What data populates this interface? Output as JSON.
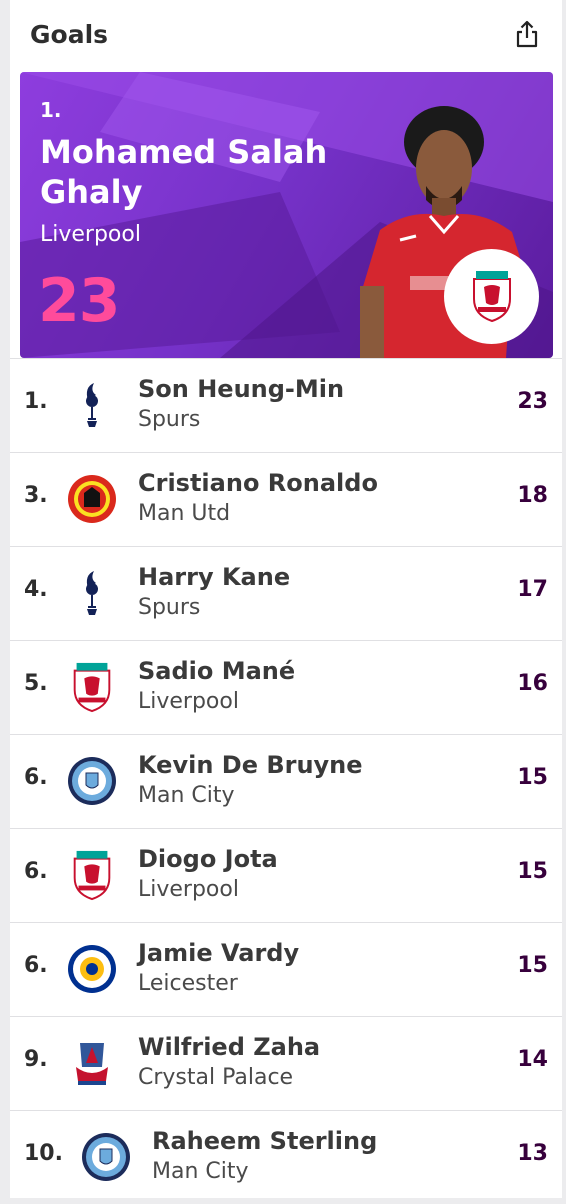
{
  "header": {
    "title": "Goals",
    "share_icon": "share-icon"
  },
  "leader": {
    "rank": "1.",
    "name": "Mohamed Salah Ghaly",
    "club": "Liverpool",
    "value": "23",
    "club_badge": "liverpool-crest"
  },
  "rows": [
    {
      "rank": "1.",
      "name": "Son Heung-Min",
      "club": "Spurs",
      "value": "23",
      "crest": "spurs-crest"
    },
    {
      "rank": "3.",
      "name": "Cristiano Ronaldo",
      "club": "Man Utd",
      "value": "18",
      "crest": "man-utd-crest"
    },
    {
      "rank": "4.",
      "name": "Harry Kane",
      "club": "Spurs",
      "value": "17",
      "crest": "spurs-crest"
    },
    {
      "rank": "5.",
      "name": "Sadio Mané",
      "club": "Liverpool",
      "value": "16",
      "crest": "liverpool-crest"
    },
    {
      "rank": "6.",
      "name": "Kevin De Bruyne",
      "club": "Man City",
      "value": "15",
      "crest": "man-city-crest"
    },
    {
      "rank": "6.",
      "name": "Diogo Jota",
      "club": "Liverpool",
      "value": "15",
      "crest": "liverpool-crest"
    },
    {
      "rank": "6.",
      "name": "Jamie Vardy",
      "club": "Leicester",
      "value": "15",
      "crest": "leicester-crest"
    },
    {
      "rank": "9.",
      "name": "Wilfried Zaha",
      "club": "Crystal Palace",
      "value": "14",
      "crest": "crystal-palace-crest"
    },
    {
      "rank": "10.",
      "name": "Raheem Sterling",
      "club": "Man City",
      "value": "13",
      "crest": "man-city-crest"
    }
  ],
  "colors": {
    "purple": "#37003c",
    "pink": "#ff4b9b",
    "hero_purple": "#7632c9"
  }
}
